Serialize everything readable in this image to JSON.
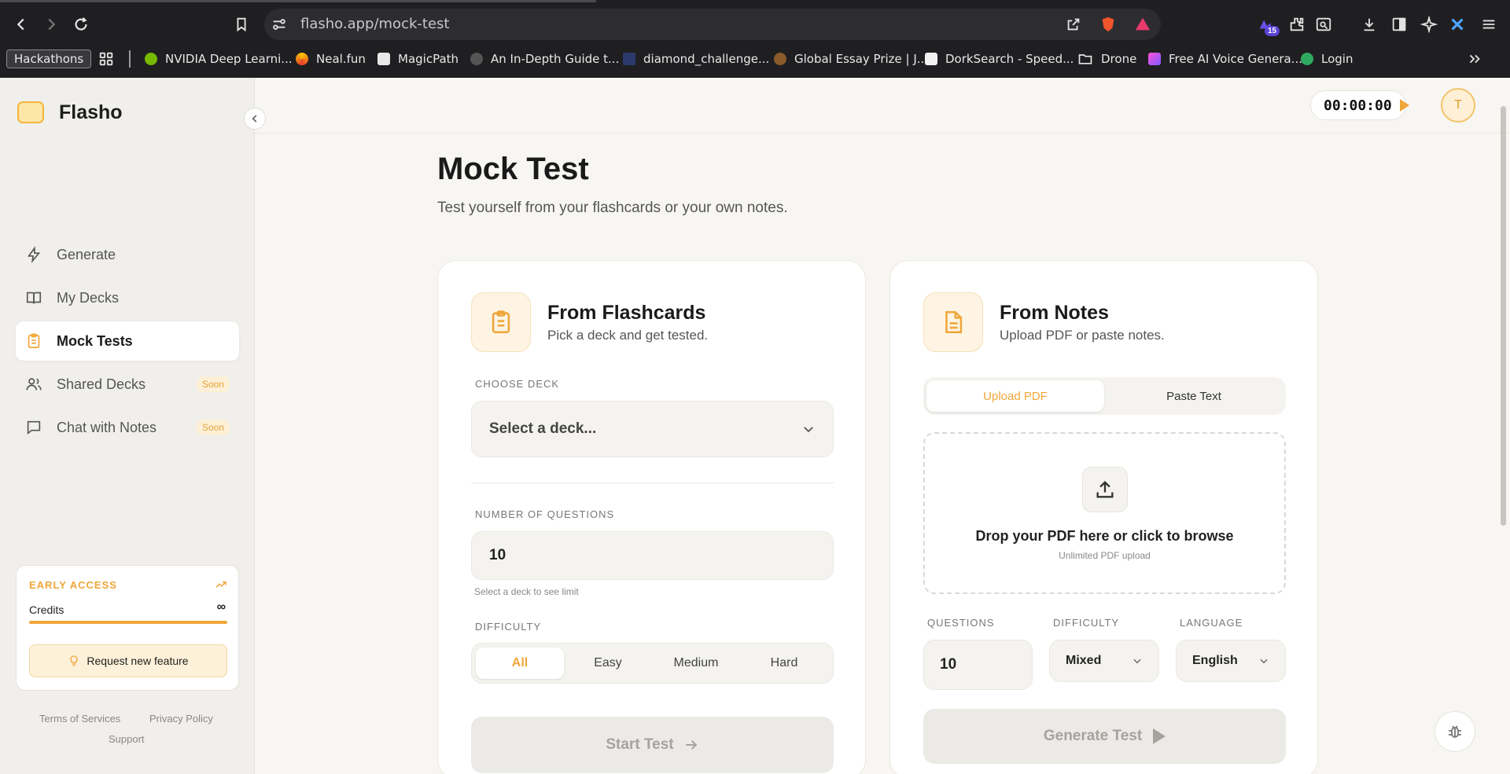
{
  "browser": {
    "url": "flasho.app/mock-test",
    "extension_badge": "15",
    "bookmarks": [
      {
        "label": "Hackathons"
      },
      {
        "label": "NVIDIA Deep Learni..."
      },
      {
        "label": "Neal.fun"
      },
      {
        "label": "MagicPath"
      },
      {
        "label": "An In-Depth Guide t..."
      },
      {
        "label": "diamond_challenge..."
      },
      {
        "label": "Global Essay Prize | J..."
      },
      {
        "label": "DorkSearch - Speed..."
      },
      {
        "label": "Drone"
      },
      {
        "label": "Free AI Voice Genera..."
      },
      {
        "label": "Login"
      }
    ]
  },
  "app": {
    "name": "Flasho",
    "nav": [
      {
        "label": "Generate",
        "icon": "lightning-icon"
      },
      {
        "label": "My Decks",
        "icon": "book-icon"
      },
      {
        "label": "Mock Tests",
        "icon": "clipboard-icon",
        "active": true
      },
      {
        "label": "Shared Decks",
        "icon": "users-icon",
        "badge": "Soon"
      },
      {
        "label": "Chat with Notes",
        "icon": "chat-icon",
        "badge": "Soon"
      }
    ],
    "access": {
      "title": "EARLY ACCESS",
      "credits_label": "Credits",
      "credits_value": "∞",
      "credits_fill": 1.0,
      "request_label": "Request new feature"
    },
    "footer": {
      "terms": "Terms of Services",
      "privacy": "Privacy Policy",
      "support": "Support"
    },
    "timer": "00:00:00",
    "avatar_initial": "T"
  },
  "page": {
    "title": "Mock Test",
    "subtitle": "Test yourself from your flashcards or your own notes."
  },
  "flashcards_card": {
    "title": "From Flashcards",
    "subtitle": "Pick a deck and get tested.",
    "deck_label": "CHOOSE DECK",
    "deck_placeholder": "Select a deck...",
    "questions_label": "NUMBER OF QUESTIONS",
    "questions_value": "10",
    "questions_hint": "Select a deck to see limit",
    "difficulty_label": "DIFFICULTY",
    "difficulty_options": [
      "All",
      "Easy",
      "Medium",
      "Hard"
    ],
    "difficulty_selected": "All",
    "start_label": "Start Test"
  },
  "notes_card": {
    "title": "From Notes",
    "subtitle": "Upload PDF or paste notes.",
    "tabs": [
      "Upload PDF",
      "Paste Text"
    ],
    "active_tab": "Upload PDF",
    "drop_main": "Drop your PDF here or click to browse",
    "drop_sub": "Unlimited PDF upload",
    "questions_label": "QUESTIONS",
    "questions_value": "10",
    "difficulty_label": "DIFFICULTY",
    "difficulty_value": "Mixed",
    "language_label": "LANGUAGE",
    "language_value": "English",
    "generate_label": "Generate Test"
  },
  "colors": {
    "accent": "#f0a63a",
    "background": "#f7f6f2",
    "chrome": "#1f1f22"
  }
}
